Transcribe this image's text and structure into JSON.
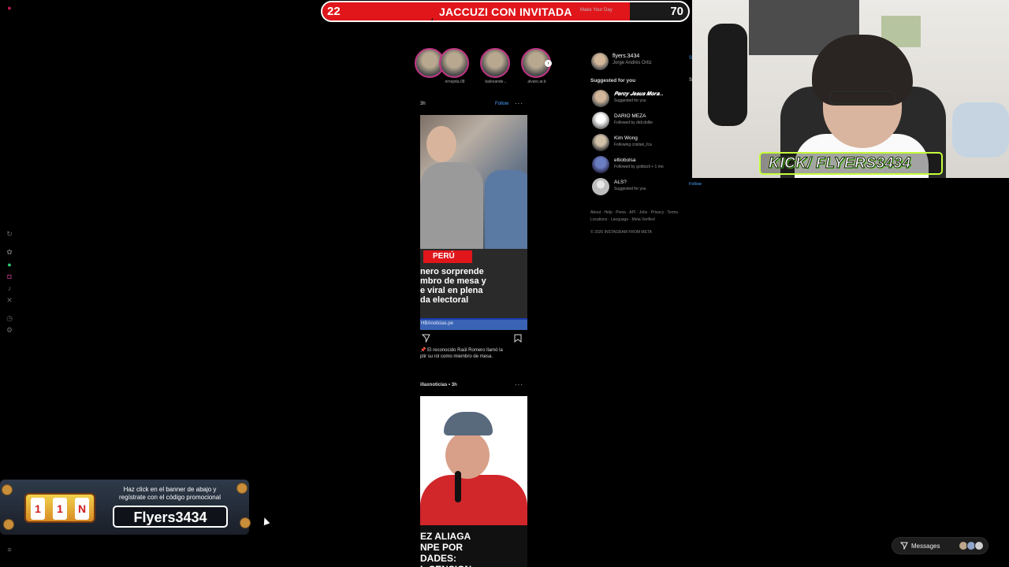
{
  "topbar": {
    "left_number": "22",
    "title": "JACCUZI CON INVITADA",
    "faded_text": "Make Your Day",
    "right_number": "70"
  },
  "instagram": {
    "stories": [
      {
        "name": ""
      },
      {
        "name": "ernejota.08"
      },
      {
        "name": "balexande..."
      },
      {
        "name": "alvaro.ar.b"
      }
    ],
    "post1": {
      "time": "3h",
      "follow_label": "Follow",
      "more": "···",
      "tag": "PERÚ",
      "headline": "nero sorprende\nmbro de mesa y\ne viral en plena\nda electoral",
      "source": "HBAnoticias.pe",
      "caption": "📌 El reconocido Raúl Romero llamó la\nplir su rol como miembro de mesa."
    },
    "post2": {
      "header": "illaxnoticias • 3h",
      "more": "···",
      "headline": "EZ ALIAGA\nNPE POR\nDADES:\n  L CENSION"
    }
  },
  "sidebar": {
    "me_username": "flyers.3434",
    "me_name": "Jorge Andrés Ortiz",
    "suggested_title": "Suggested for you",
    "suggestions": [
      {
        "name": "𝑷𝒆𝒓𝒄𝒚 𝑱𝒆𝒔𝒖𝒔 𝑴𝒐𝒓𝒂...",
        "sub": "Suggested for you"
      },
      {
        "name": "DARIO MEZA",
        "sub": "Followed by didi.dollie"
      },
      {
        "name": "Kim Wong",
        "sub": "Following cristian_fca"
      },
      {
        "name": "eltiobolsa",
        "sub": "Followed by goldizzli + 1 mo"
      },
      {
        "name": "ALS?",
        "sub": "Suggested for you",
        "follow": "Follow"
      }
    ],
    "footer_links": "About · Help · Press · API · Jobs · Privacy · Terms ·\nLocations · Language · Meta Verified",
    "copyright": "© 2026 INSTAGRAM FROM META"
  },
  "stream": {
    "kick_badge": "KICK/ FLYERS3434"
  },
  "messages": {
    "label": "Messages"
  },
  "promo": {
    "text": "Haz click en el banner de abajo  y\nregístrate con el código promocional",
    "code": "Flyers3434"
  },
  "colors": {
    "accent_red": "#e0161b",
    "ig_blue": "#4aa3ff",
    "kick_green": "#c6ff3a"
  }
}
